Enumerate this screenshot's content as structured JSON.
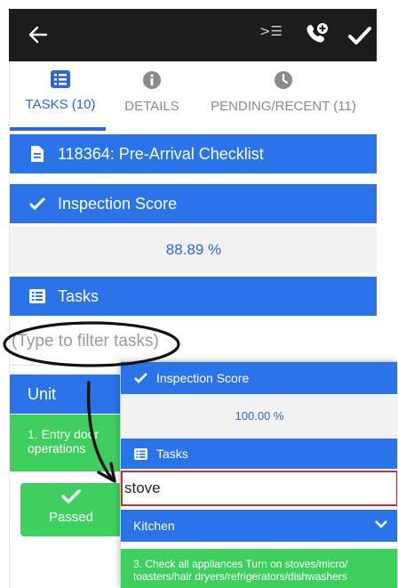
{
  "header": {
    "outline_glyph": ">☰"
  },
  "tabs": [
    {
      "label": "TASKS (10)",
      "icon": "list-icon"
    },
    {
      "label": "DETAILS",
      "icon": "info-icon"
    },
    {
      "label": "PENDING/RECENT (11)",
      "icon": "clock-icon"
    }
  ],
  "checklist": {
    "title": "118364: Pre-Arrival Checklist"
  },
  "inspection": {
    "label": "Inspection Score",
    "score": "88.89 %"
  },
  "tasks_section": {
    "label": "Tasks",
    "filter_placeholder": "(Type to filter tasks)",
    "unit_label": "Unit",
    "first_task": "1. Entry door\noperations",
    "passed_label": "Passed"
  },
  "overlay": {
    "inspection_label": "Inspection Score",
    "score": "100.00 %",
    "tasks_label": "Tasks",
    "filter_value": "stove",
    "group_label": "Kitchen",
    "task_text": "3. Check all appliances Turn on stoves/micro/\ntoasters/hair dryers/refrigerators/dishwashers"
  },
  "colors": {
    "header_bg": "#1c1c1c",
    "primary_blue": "#2a73e8",
    "accent_text": "#2a66d6",
    "pass_green": "#3fcf5f",
    "highlight_red": "#c2313f"
  }
}
